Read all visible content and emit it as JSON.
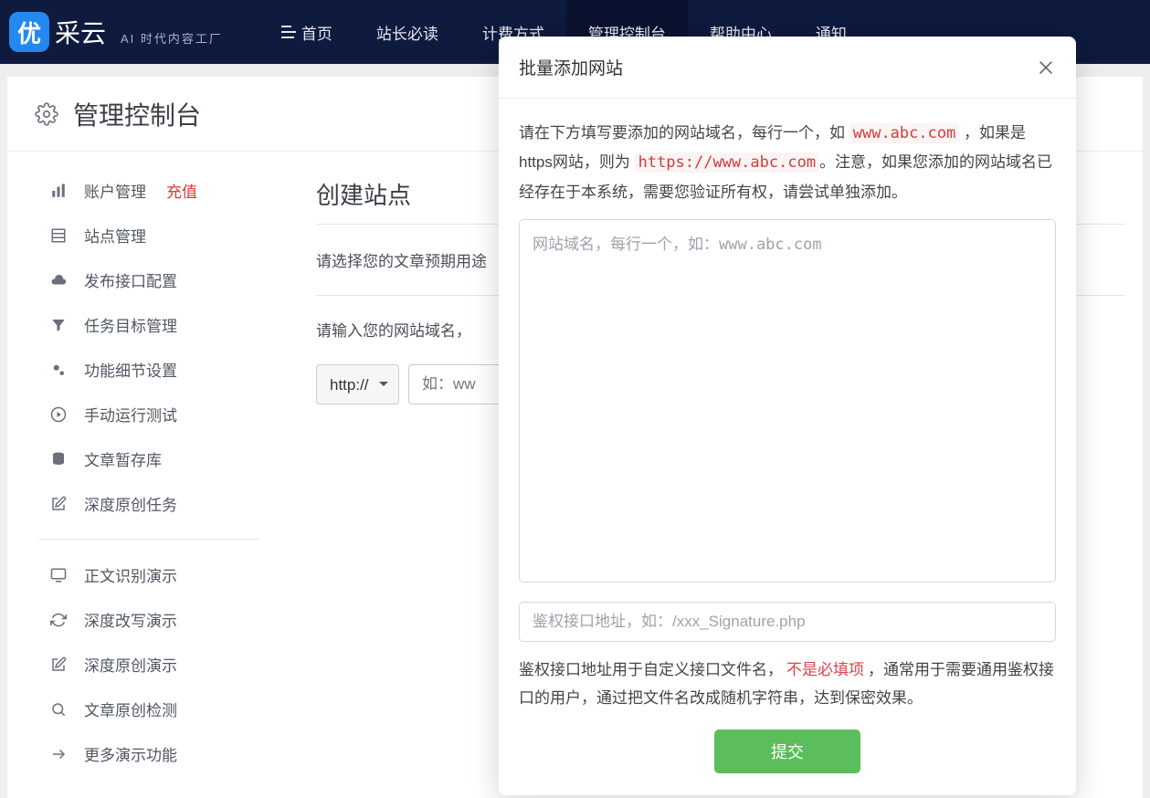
{
  "header": {
    "logo_badge": "优",
    "logo_text": "采云",
    "logo_sub": "AI 时代内容工厂",
    "nav": [
      {
        "label": "首页"
      },
      {
        "label": "站长必读"
      },
      {
        "label": "计费方式"
      },
      {
        "label": "管理控制台"
      },
      {
        "label": "帮助中心"
      },
      {
        "label": "通知"
      }
    ]
  },
  "page_title": "管理控制台",
  "sidebar": {
    "items1": [
      {
        "label": "账户管理",
        "badge": "充值"
      },
      {
        "label": "站点管理"
      },
      {
        "label": "发布接口配置"
      },
      {
        "label": "任务目标管理"
      },
      {
        "label": "功能细节设置"
      },
      {
        "label": "手动运行测试"
      },
      {
        "label": "文章暂存库"
      },
      {
        "label": "深度原创任务"
      }
    ],
    "items2": [
      {
        "label": "正文识别演示"
      },
      {
        "label": "深度改写演示"
      },
      {
        "label": "深度原创演示"
      },
      {
        "label": "文章原创检测"
      },
      {
        "label": "更多演示功能"
      }
    ]
  },
  "main": {
    "title": "创建站点",
    "label1": "请选择您的文章预期用途",
    "label2": "请输入您的网站域名，",
    "proto": "http://",
    "placeholder": "如：ww"
  },
  "modal": {
    "title": "批量添加网站",
    "desc_a": "请在下方填写要添加的网站域名，每行一个，如 ",
    "code1": "www.abc.com",
    "desc_b": " ，如果是https网站，则为 ",
    "code2": "https://www.abc.com",
    "desc_c": "。注意，如果您添加的网站域名已经存在于本系统，需要您验证所有权，请尝试单独添加。",
    "ta_ph": "网站域名，每行一个，如：www.abc.com",
    "sig_ph": "鉴权接口地址，如：/xxx_Signature.php",
    "desc2_a": "鉴权接口地址用于自定义接口文件名，",
    "opt": "不是必填项",
    "desc2_b": "，通常用于需要通用鉴权接口的用户，通过把文件名改成随机字符串，达到保密效果。",
    "submit": "提交"
  }
}
